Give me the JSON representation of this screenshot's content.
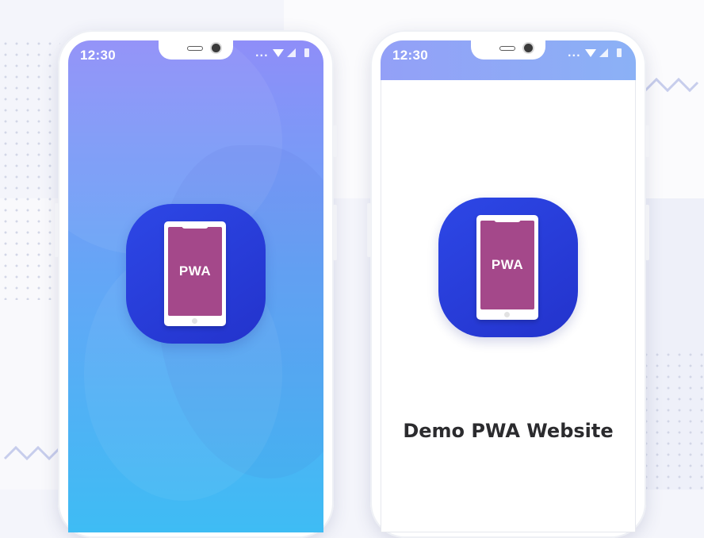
{
  "colors": {
    "splash_gradient_top": "#8f8ef8",
    "splash_gradient_bottom": "#3ebcf4",
    "status_bar": "#93a0f7",
    "icon_blue": "#2d47e6",
    "icon_screen_purple": "#a4488a",
    "title_text": "#2b2b2e"
  },
  "phones": [
    {
      "status_bar": {
        "time": "12:30",
        "overflow": "...",
        "icons": [
          "wifi-icon",
          "signal-icon",
          "battery-icon"
        ]
      },
      "screen": "gradient-splash",
      "app_icon": {
        "label": "PWA"
      }
    },
    {
      "status_bar": {
        "time": "12:30",
        "overflow": "...",
        "icons": [
          "wifi-icon",
          "signal-icon",
          "battery-icon"
        ]
      },
      "screen": "white-splash",
      "app_icon": {
        "label": "PWA"
      },
      "site_title": "Demo PWA Website"
    }
  ]
}
